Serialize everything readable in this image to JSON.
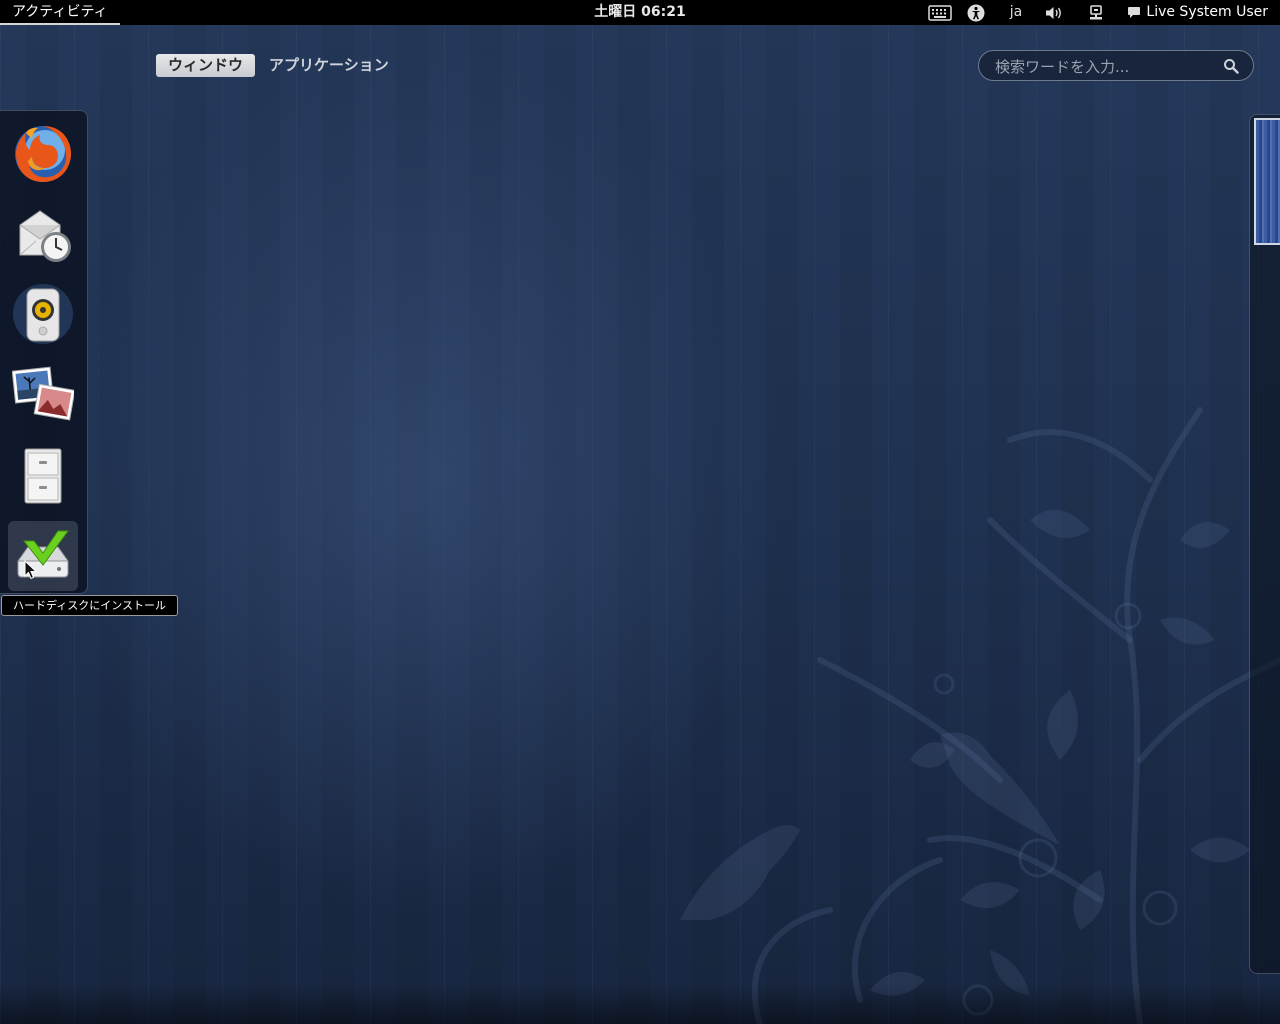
{
  "topbar": {
    "activities_label": "アクティビティ",
    "clock": "土曜日 06:21",
    "language": "ja",
    "user_name": "Live System User"
  },
  "overview": {
    "tabs": [
      {
        "label": "ウィンドウ",
        "active": true
      },
      {
        "label": "アプリケーション",
        "active": false
      }
    ],
    "search_placeholder": "検索ワードを入力..."
  },
  "dash": {
    "items": [
      {
        "icon": "firefox-icon"
      },
      {
        "icon": "mail-clock-icon"
      },
      {
        "icon": "speaker-icon"
      },
      {
        "icon": "photos-icon"
      },
      {
        "icon": "file-cabinet-icon"
      },
      {
        "icon": "install-to-disk-icon",
        "hovered": true
      }
    ],
    "tooltip": "ハードディスクにインストール"
  },
  "workspaces": {
    "count": 1
  },
  "colors": {
    "topbar": "#000000",
    "background": "#1f3150",
    "install_green": "#6ad01f",
    "workspace_thumb": "#3d5ea6"
  }
}
